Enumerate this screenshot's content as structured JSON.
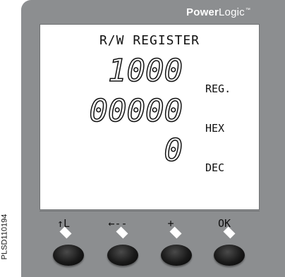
{
  "brand": {
    "bold": "Power",
    "light": "Logic",
    "mark": "™"
  },
  "lcd": {
    "title": "R/W REGISTER",
    "rows": [
      {
        "value": "1000",
        "unit": "REG."
      },
      {
        "value": "00000",
        "unit": "HEX"
      },
      {
        "value": "0",
        "unit": "DEC"
      }
    ]
  },
  "softkeys": [
    "↑L",
    "←--",
    "+",
    "OK"
  ],
  "figure_code": "PLSD110194"
}
